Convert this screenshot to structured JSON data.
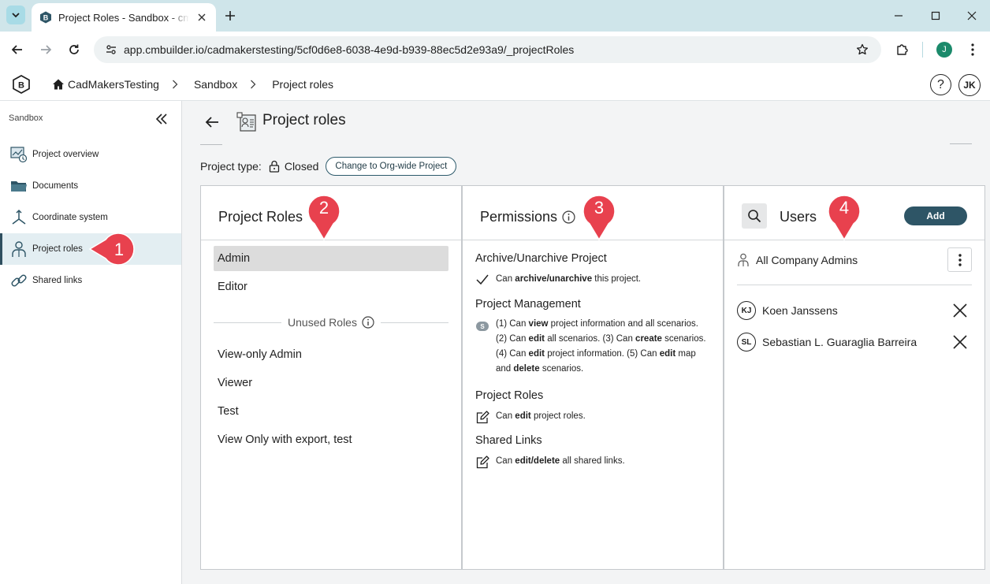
{
  "browser": {
    "tab_title": "Project Roles - Sandbox - cmBuilder",
    "url": "app.cmbuilder.io/cadmakerstesting/5cf0d6e8-6038-4e9d-b939-88ec5d2e93a9/_projectRoles",
    "profile_initial": "J"
  },
  "header": {
    "breadcrumb": [
      "CadMakersTesting",
      "Sandbox",
      "Project roles"
    ],
    "help_label": "?",
    "user_initials": "JK"
  },
  "sidebar": {
    "title": "Sandbox",
    "items": [
      {
        "label": "Project overview",
        "icon": "project-overview-icon"
      },
      {
        "label": "Documents",
        "icon": "folder-icon"
      },
      {
        "label": "Coordinate system",
        "icon": "axes-icon"
      },
      {
        "label": "Project roles",
        "icon": "user-roles-icon",
        "active": true
      },
      {
        "label": "Shared links",
        "icon": "link-icon"
      }
    ]
  },
  "page": {
    "title": "Project roles",
    "project_type_label": "Project type:",
    "project_type_value": "Closed",
    "change_button": "Change to Org-wide Project"
  },
  "roles_panel": {
    "title": "Project Roles",
    "roles": [
      "Admin",
      "Editor"
    ],
    "selected_role": "Admin",
    "unused_label": "Unused Roles",
    "unused_roles": [
      "View-only Admin",
      "Viewer",
      "Test",
      "View Only with export, test"
    ]
  },
  "permissions_panel": {
    "title": "Permissions",
    "groups": [
      {
        "heading": "Archive/Unarchive Project",
        "icon": "check-icon",
        "lines": [
          [
            "Can ",
            "archive/unarchive",
            " this project."
          ]
        ]
      },
      {
        "heading": "Project Management",
        "icon": "scenario-badge",
        "badge": "S",
        "lines": [
          [
            "(1) Can ",
            "view",
            " project information and all scenarios."
          ],
          [
            "(2) Can ",
            "edit",
            " all scenarios. (3) Can ",
            "create",
            " scenarios."
          ],
          [
            "(4) Can ",
            "edit",
            " project information. (5) Can ",
            "edit",
            " map"
          ],
          [
            "and ",
            "delete",
            " scenarios."
          ]
        ]
      },
      {
        "heading": "Project Roles",
        "icon": "edit-icon",
        "lines": [
          [
            "Can ",
            "edit",
            " project roles."
          ]
        ]
      },
      {
        "heading": "Shared Links",
        "icon": "edit-icon",
        "lines": [
          [
            "Can ",
            "edit/delete",
            " all shared links."
          ]
        ]
      }
    ]
  },
  "users_panel": {
    "title": "Users",
    "add_button": "Add",
    "group_row": "All Company Admins",
    "users": [
      {
        "initials": "KJ",
        "name": "Koen Janssens"
      },
      {
        "initials": "SL",
        "name": "Sebastian L. Guaraglia Barreira"
      }
    ]
  },
  "callouts": [
    "1",
    "2",
    "3",
    "4"
  ],
  "colors": {
    "accent": "#2e5566",
    "callout": "#e8414e",
    "tabstrip": "#cfe5ea",
    "selected_role_bg": "#dcdcdc",
    "active_nav_bg": "#e3eef2"
  }
}
